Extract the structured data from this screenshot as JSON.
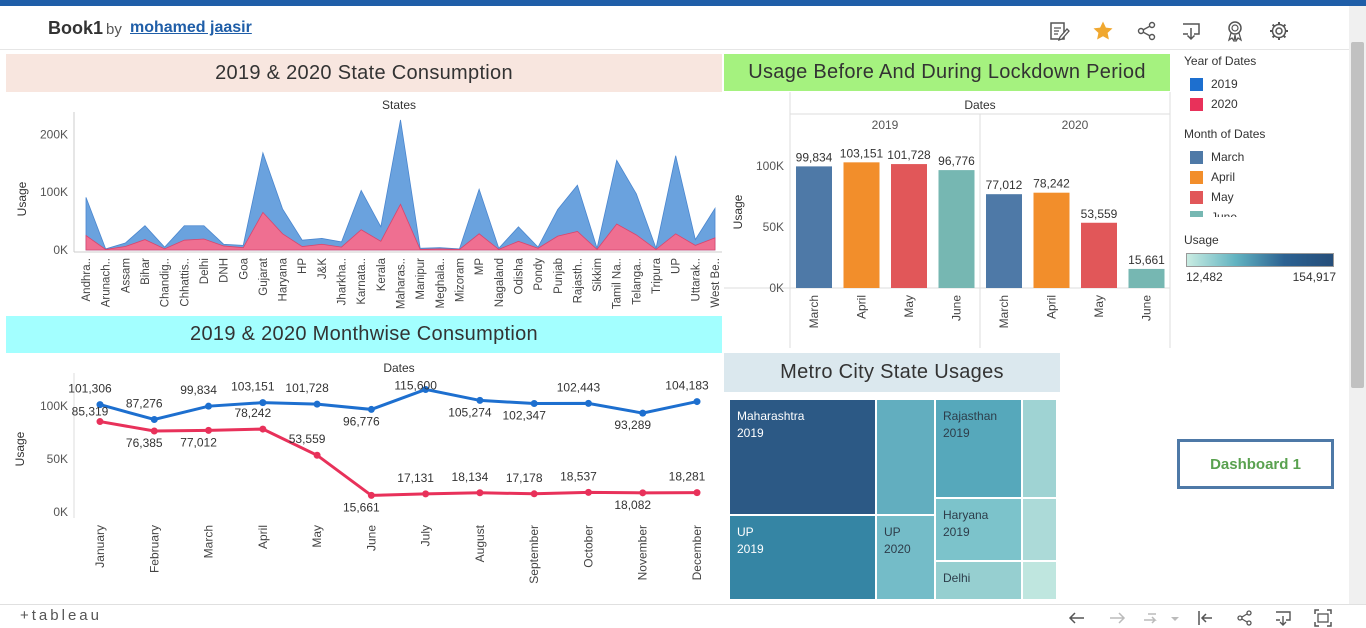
{
  "header": {
    "book_title": "Book1",
    "by_label": "by",
    "author": "mohamed jaasir"
  },
  "header_icons": [
    "edit-icon",
    "favorite-star-icon",
    "share-icon",
    "download-icon",
    "badge-icon",
    "settings-gear-icon"
  ],
  "colors": {
    "y2019": "#1d6fcf",
    "y2020": "#e8315a",
    "area2019": "#6aa2de",
    "area2020": "#ef6f91",
    "march": "#4e79a7",
    "april": "#f28e2b",
    "may": "#e15759",
    "june": "#76b7b2",
    "accent": "#1f5ea8"
  },
  "state_chart": {
    "title": "2019 & 2020 State Consumption",
    "header": "States",
    "ylabel": "Usage",
    "ticks": [
      "200K",
      "100K",
      "0K"
    ]
  },
  "lockdown_chart": {
    "title": "Usage Before And During Lockdown Period",
    "header": "Dates",
    "ylabel": "Usage",
    "ticks": [
      "100K",
      "50K",
      "0K"
    ]
  },
  "month_chart": {
    "title": "2019 & 2020 Monthwise Consumption",
    "header": "Dates",
    "ylabel": "Usage",
    "ticks": [
      "100K",
      "50K",
      "0K"
    ]
  },
  "treemap": {
    "title": "Metro City State Usages",
    "cells": [
      {
        "name": "Maharashtra",
        "year": "2019",
        "shade": "#2c5985"
      },
      {
        "name": "",
        "year": "",
        "shade": "#62aebf"
      },
      {
        "name": "Rajasthan",
        "year": "2019",
        "shade": "#56a8bb"
      },
      {
        "name": "",
        "year": "",
        "shade": "#9fd3d3"
      },
      {
        "name": "UP",
        "year": "2019",
        "shade": "#3585a4"
      },
      {
        "name": "UP",
        "year": "2020",
        "shade": "#74bcc8"
      },
      {
        "name": "Haryana",
        "year": "2019",
        "shade": "#7cc3cb"
      },
      {
        "name": "",
        "year": "",
        "shade": "#acdad8"
      },
      {
        "name": "Delhi",
        "year": "",
        "shade": "#96cfd0"
      },
      {
        "name": "",
        "year": "",
        "shade": "#bfe6df"
      }
    ]
  },
  "legend": {
    "year_title": "Year of Dates",
    "years": [
      {
        "label": "2019",
        "color": "#1d6fcf"
      },
      {
        "label": "2020",
        "color": "#e8315a"
      }
    ],
    "month_title": "Month of Dates",
    "months": [
      {
        "label": "March",
        "color": "#4e79a7"
      },
      {
        "label": "April",
        "color": "#f28e2b"
      },
      {
        "label": "May",
        "color": "#e15759"
      },
      {
        "label": "June",
        "color": "#76b7b2"
      }
    ],
    "usage_title": "Usage",
    "usage_min": "12,482",
    "usage_max": "154,917"
  },
  "dashboard_button": "Dashboard 1",
  "footer": {
    "logo": "+tableau",
    "icons": [
      "undo-icon",
      "redo-icon",
      "revert-icon",
      "revert-dropdown-icon",
      "reset-icon",
      "share-icon",
      "download-icon",
      "fullscreen-icon"
    ]
  },
  "chart_data": [
    {
      "type": "area",
      "title": "2019 & 2020 State Consumption",
      "xlabel": "States",
      "ylabel": "Usage",
      "ylim": [
        0,
        230000
      ],
      "categories": [
        "Andhra..",
        "Arunach..",
        "Assam",
        "Bihar",
        "Chandig..",
        "Chhattis..",
        "Delhi",
        "DNH",
        "Goa",
        "Gujarat",
        "Haryana",
        "HP",
        "J&K",
        "Jharkha..",
        "Karnata..",
        "Kerala",
        "Maharas..",
        "Manipur",
        "Meghala..",
        "Mizoram",
        "MP",
        "Nagaland",
        "Odisha",
        "Pondy",
        "Punjab",
        "Rajasth..",
        "Sikkim",
        "Tamil Na..",
        "Telanga..",
        "Tripura",
        "UP",
        "Uttarak..",
        "West Be.."
      ],
      "series": [
        {
          "name": "2019",
          "values": [
            91000,
            2000,
            12000,
            42000,
            5000,
            42000,
            42000,
            10000,
            8000,
            168000,
            71000,
            17000,
            20000,
            14000,
            103000,
            40000,
            225000,
            3000,
            4000,
            2000,
            105000,
            3000,
            40000,
            5000,
            70000,
            112000,
            3000,
            155000,
            97000,
            3000,
            163000,
            18000,
            72000
          ]
        },
        {
          "name": "2020",
          "values": [
            25000,
            1000,
            6000,
            18000,
            2000,
            17000,
            19000,
            7000,
            4000,
            65000,
            28000,
            6000,
            10000,
            5000,
            35000,
            15000,
            79000,
            1000,
            2000,
            1000,
            28000,
            1000,
            15000,
            3000,
            24000,
            32000,
            1000,
            45000,
            26000,
            1000,
            28000,
            8000,
            21000
          ]
        }
      ]
    },
    {
      "type": "bar",
      "title": "Usage Before And During Lockdown Period",
      "xlabel": "Dates",
      "ylabel": "Usage",
      "ylim": [
        0,
        110000
      ],
      "groups": [
        "2019",
        "2020"
      ],
      "categories": [
        "March",
        "April",
        "May",
        "June"
      ],
      "series": [
        {
          "name": "2019",
          "values": [
            99834,
            103151,
            101728,
            96776
          ],
          "labels": [
            "99,834",
            "103,151",
            "101,728",
            "96,776"
          ]
        },
        {
          "name": "2020",
          "values": [
            77012,
            78242,
            53559,
            15661
          ],
          "labels": [
            "77,012",
            "78,242",
            "53,559",
            "15,661"
          ]
        }
      ]
    },
    {
      "type": "line",
      "title": "2019 & 2020 Monthwise Consumption",
      "xlabel": "Dates",
      "ylabel": "Usage",
      "ylim": [
        0,
        120000
      ],
      "categories": [
        "January",
        "February",
        "March",
        "April",
        "May",
        "June",
        "July",
        "August",
        "September",
        "October",
        "November",
        "December"
      ],
      "series": [
        {
          "name": "2019",
          "values": [
            101306,
            87276,
            99834,
            103151,
            101728,
            96776,
            115600,
            105274,
            102347,
            102443,
            93289,
            104183
          ],
          "labels": [
            "101,306",
            "87,276",
            "99,834",
            "103,151",
            "101,728",
            "96,776",
            "115,600",
            "105,274",
            "102,347",
            "102,443",
            "93,289",
            "104,183"
          ]
        },
        {
          "name": "2020",
          "values": [
            85319,
            76385,
            77012,
            78242,
            53559,
            15661,
            17131,
            18134,
            17178,
            18537,
            18082,
            18281
          ],
          "labels": [
            "85,319",
            "76,385",
            "77,012",
            "78,242",
            "53,559",
            "15,661",
            "17,131",
            "18,134",
            "17,178",
            "18,537",
            "18,082",
            "18,281"
          ]
        }
      ]
    }
  ]
}
